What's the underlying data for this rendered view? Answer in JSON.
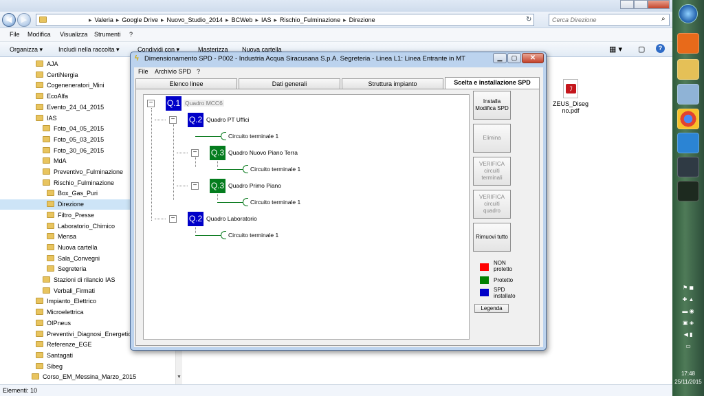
{
  "explorer": {
    "breadcrumbs": [
      "Valeria",
      "Google Drive",
      "Nuovo_Studio_2014",
      "BCWeb",
      "IAS",
      "Rischio_Fulminazione",
      "Direzione"
    ],
    "search_placeholder": "Cerca Direzione",
    "menu": [
      "File",
      "Modifica",
      "Visualizza",
      "Strumenti",
      "?"
    ],
    "toolbar": [
      "Organizza ▾",
      "Includi nella raccolta ▾",
      "Condividi con ▾",
      "Masterizza",
      "Nuova cartella"
    ],
    "tree": [
      {
        "label": "AJA",
        "level": 0
      },
      {
        "label": "CertiNergia",
        "level": 0
      },
      {
        "label": "Cogeneneratori_Mini",
        "level": 0
      },
      {
        "label": "EcoAlfa",
        "level": 0
      },
      {
        "label": "Evento_24_04_2015",
        "level": 0
      },
      {
        "label": "IAS",
        "level": 0
      },
      {
        "label": "Foto_04_05_2015",
        "level": 1
      },
      {
        "label": "Foto_05_03_2015",
        "level": 1
      },
      {
        "label": "Foto_30_06_2015",
        "level": 1
      },
      {
        "label": "MdA",
        "level": 1
      },
      {
        "label": "Preventivo_Fulminazione",
        "level": 1
      },
      {
        "label": "Rischio_Fulminazione",
        "level": 1
      },
      {
        "label": "Box_Gas_Puri",
        "level": 2
      },
      {
        "label": "Direzione",
        "level": 2,
        "selected": true
      },
      {
        "label": "Filtro_Presse",
        "level": 2
      },
      {
        "label": "Laboratorio_Chimico",
        "level": 2
      },
      {
        "label": "Mensa",
        "level": 2
      },
      {
        "label": "Nuova cartella",
        "level": 2
      },
      {
        "label": "Sala_Convegni",
        "level": 2
      },
      {
        "label": "Segreteria",
        "level": 2
      },
      {
        "label": "Stazioni di rilancio  IAS",
        "level": 1
      },
      {
        "label": "Verbali_Firmati",
        "level": 1
      },
      {
        "label": "Impianto_Elettrico",
        "level": 0
      },
      {
        "label": "Microelettrica",
        "level": 0
      },
      {
        "label": "OIPneus",
        "level": 0
      },
      {
        "label": "Preventivi_Diagnosi_Energetica",
        "level": 0
      },
      {
        "label": "Referenze_EGE",
        "level": 0
      },
      {
        "label": "Santagati",
        "level": 0
      },
      {
        "label": "Sibeg",
        "level": 0
      },
      {
        "label": "Corso_EM_Messina_Marzo_2015",
        "level": -1
      }
    ],
    "file": {
      "name_line1": "ZEUS_Diseg",
      "name_line2": "no.pdf"
    },
    "status": "Elementi: 10"
  },
  "dialog": {
    "title": "Dimensionamento SPD   -  P002 - Industria Acqua Siracusana S.p.A. Segreteria  -  Linea L1:  Linea Entrante in MT",
    "menu": [
      "File",
      "Archivio SPD",
      "?"
    ],
    "tabs": [
      "Elenco linee",
      "Dati generali",
      "Struttura impianto",
      "Scelta e installazione SPD"
    ],
    "active_tab": "Scelta e installazione SPD",
    "nodes": {
      "q1": {
        "code": "Q.1",
        "label": "Quadro MCC6"
      },
      "q2a": {
        "code": "Q.2",
        "label": "Quadro PT Uffici"
      },
      "c1": {
        "label": "Circuito terminale 1"
      },
      "q3a": {
        "code": "Q.3",
        "label": "Quadro Nuovo Piano Terra"
      },
      "c2": {
        "label": "Circuito terminale 1"
      },
      "q3b": {
        "code": "Q.3",
        "label": "Quadro Primo Piano"
      },
      "c3": {
        "label": "Circuito terminale 1"
      },
      "q2b": {
        "code": "Q.2",
        "label": "Quadro Laboratorio"
      },
      "c4": {
        "label": "Circuito terminale 1"
      }
    },
    "buttons": {
      "install": [
        "Installa",
        "Modifica SPD"
      ],
      "delete": "Elimina",
      "verify_terminal": [
        "VERIFICA",
        "circuiti",
        "terminali"
      ],
      "verify_panel": [
        "VERIFICA",
        "circuiti",
        "quadro"
      ],
      "remove_all": "Rimuovi tutto",
      "legend": "Legenda"
    },
    "legend": [
      {
        "color": "#ff0000",
        "line1": "NON",
        "line2": "protetto"
      },
      {
        "color": "#008000",
        "line1": "Protetto",
        "line2": ""
      },
      {
        "color": "#0000c8",
        "line1": "SPD",
        "line2": "installato"
      }
    ]
  },
  "taskbar": {
    "time": "17:48",
    "date": "25/11/2015"
  }
}
